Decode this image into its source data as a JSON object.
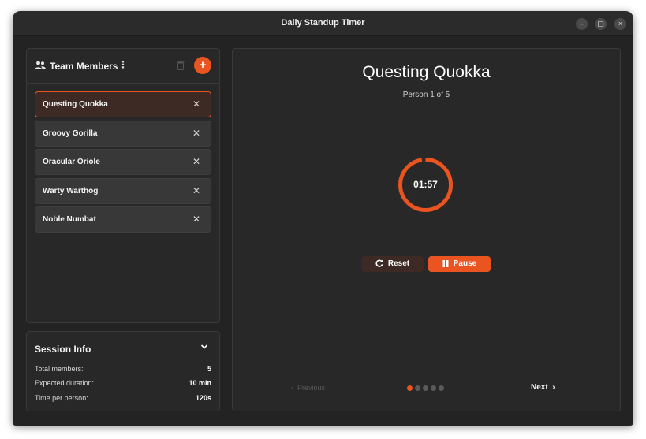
{
  "window": {
    "title": "Daily Standup Timer",
    "controls": {
      "minimize": "–",
      "maximize": "▢",
      "close": "×"
    }
  },
  "members_panel": {
    "title": "Team Members",
    "menu_icon": "⋮",
    "add_icon": "+",
    "icons": {
      "team": "people-icon",
      "delete": "trash-icon",
      "add": "plus-icon"
    },
    "items": [
      {
        "name": "Questing Quokka",
        "active": true
      },
      {
        "name": "Groovy Gorilla",
        "active": false
      },
      {
        "name": "Oracular Oriole",
        "active": false
      },
      {
        "name": "Warty Warthog",
        "active": false
      },
      {
        "name": "Noble Numbat",
        "active": false
      }
    ],
    "remove_icon": "✕"
  },
  "session_info": {
    "title": "Session Info",
    "rows": [
      {
        "label": "Total members:",
        "value": "5"
      },
      {
        "label": "Expected duration:",
        "value": "10 min"
      },
      {
        "label": "Time per person:",
        "value": "120s"
      }
    ]
  },
  "current": {
    "person": "Questing Quokka",
    "progress": "Person 1 of 5",
    "timer": "01:57",
    "timer_remaining_fraction": 0.975
  },
  "controls": {
    "reset_label": "Reset",
    "pause_label": "Pause",
    "previous_label": "Previous",
    "next_label": "Next",
    "current_index": 0,
    "total": 5
  },
  "colors": {
    "accent": "#e95420",
    "window_bg": "#232323",
    "panel_bg": "#282828",
    "inactive": "#5a5a5a"
  }
}
